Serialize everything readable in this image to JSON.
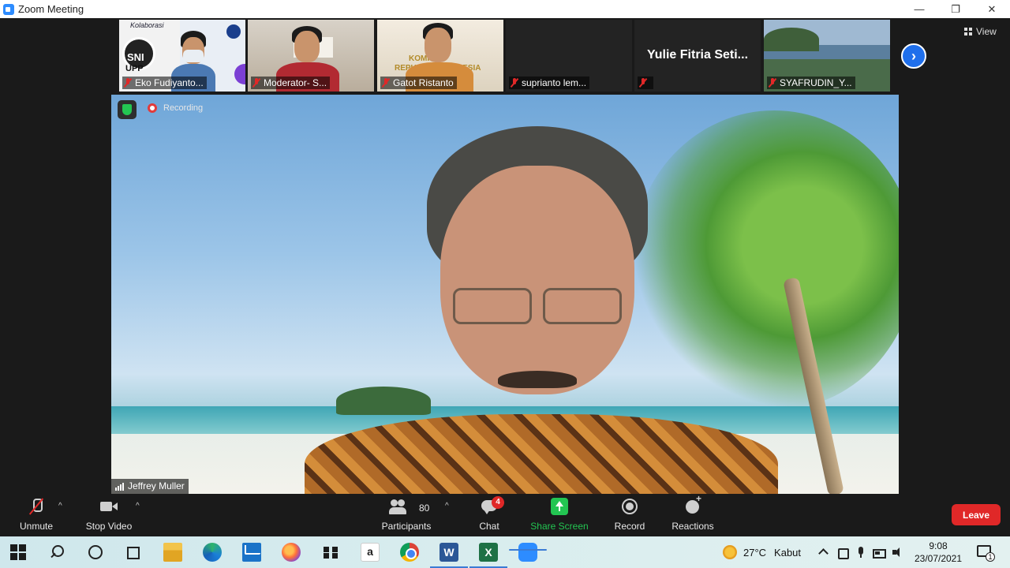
{
  "window": {
    "title": "Zoom Meeting",
    "controls": [
      "—",
      "❐",
      "✕"
    ]
  },
  "thumbnails": [
    {
      "name": "Eko Fudiyanto...",
      "muted": true,
      "sign_lines": [
        "Kolaborasi",
        "SNI",
        "UPP"
      ]
    },
    {
      "name": "Moderator- S...",
      "muted": true
    },
    {
      "name": "Gatot Ristanto",
      "muted": true,
      "sign_lines": [
        "KOMISI",
        "REPUBLIK INDONESIA"
      ]
    },
    {
      "name": "suprianto lem...",
      "muted": true
    },
    {
      "name": "",
      "display_name": "Yulie Fitria Seti...",
      "muted": true
    },
    {
      "name": "SYAFRUDIN_Y...",
      "muted": true
    }
  ],
  "view_button": {
    "label": "View"
  },
  "next_page": {
    "icon": "chevron-right-icon",
    "glyph": "›"
  },
  "main_video": {
    "speaker": "Jeffrey Muller",
    "recording_label": "Recording"
  },
  "toolbar": {
    "unmute": "Unmute",
    "stop_video": "Stop Video",
    "participants": "Participants",
    "participants_count": "80",
    "chat": "Chat",
    "chat_badge": "4",
    "share_screen": "Share Screen",
    "record": "Record",
    "reactions": "Reactions",
    "leave": "Leave",
    "caret": "^"
  },
  "taskbar": {
    "weather_temp": "27°C",
    "weather_text": "Kabut",
    "time": "9:08",
    "date": "23/07/2021",
    "notification_count": "1",
    "word_letter": "W",
    "excel_letter": "X",
    "amazon_letter": "a"
  },
  "colors": {
    "accent": "#2d8cff",
    "leave": "#e02828",
    "share_green": "#23c552",
    "mute_red": "#e02828"
  }
}
